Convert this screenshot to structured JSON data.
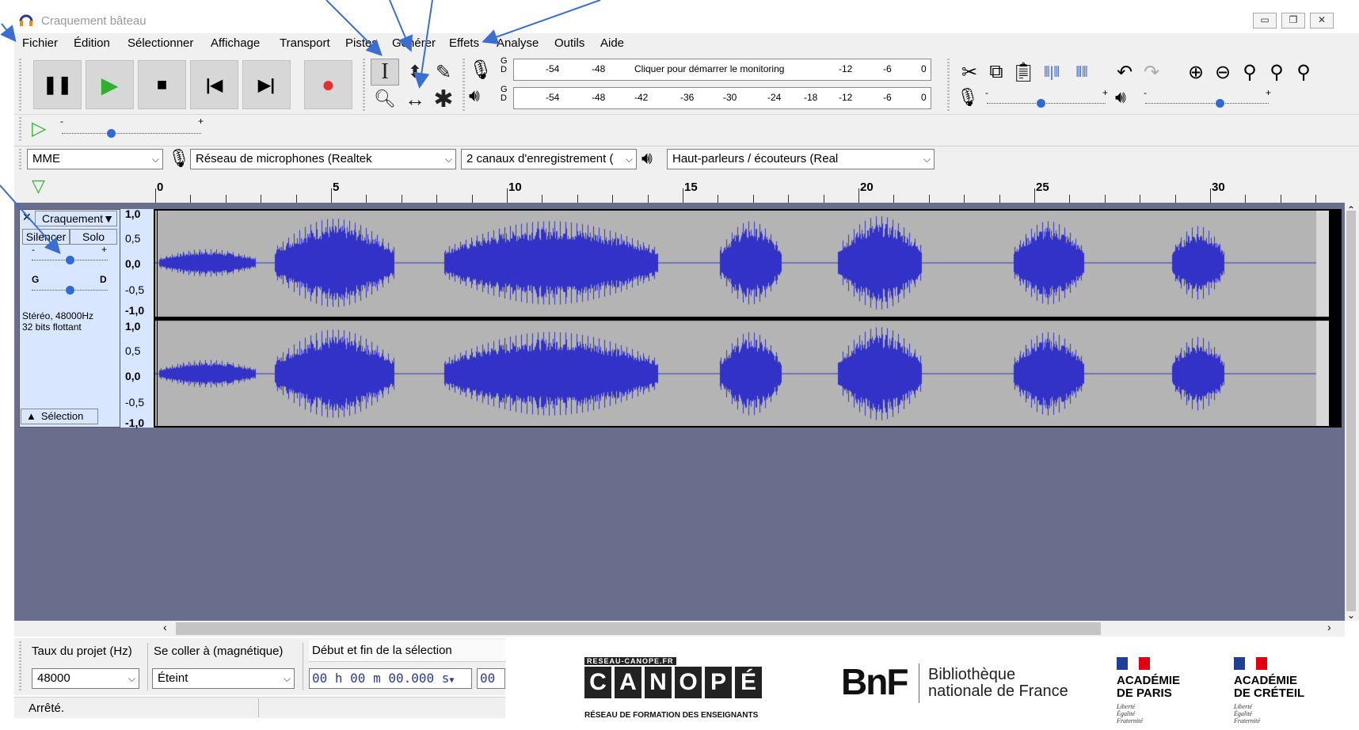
{
  "window": {
    "title": "Craquement bâteau",
    "controls": [
      "minimize",
      "restore",
      "close"
    ]
  },
  "menu": [
    "Fichier",
    "Édition",
    "Sélectionner",
    "Affichage",
    "Transport",
    "Pistes",
    "Générer",
    "Effets",
    "Analyse",
    "Outils",
    "Aide"
  ],
  "transport": {
    "buttons": [
      "pause-icon",
      "play-icon",
      "stop-icon",
      "skip-start-icon",
      "skip-end-icon",
      "record-icon"
    ]
  },
  "tools": [
    "selection-tool-icon",
    "envelope-tool-icon",
    "draw-tool-icon",
    "zoom-tool-icon",
    "timeshift-tool-icon",
    "multi-tool-icon"
  ],
  "meters": {
    "record": {
      "channels": [
        "G",
        "D"
      ],
      "labels": [
        "-54",
        "-48",
        "Cliquer pour démarrer le monitoring",
        "-12",
        "-6",
        "0"
      ]
    },
    "play": {
      "channels": [
        "G",
        "D"
      ],
      "labels": [
        "-54",
        "-48",
        "-42",
        "-36",
        "-30",
        "-24",
        "-18",
        "-12",
        "-6",
        "0"
      ]
    }
  },
  "mixer": {
    "min": "-",
    "max": "+",
    "record_volume": 0.45,
    "play_volume": 0.6
  },
  "play_at_speed": {
    "min": "-",
    "max": "+",
    "speed": 0.35
  },
  "devices": {
    "host": "MME",
    "input": "Réseau de microphones (Realtek",
    "channels": "2 canaux d'enregistrement (",
    "output": "Haut-parleurs / écouteurs (Real"
  },
  "timeline": {
    "labels": [
      "0",
      "5",
      "10",
      "15",
      "20",
      "25",
      "30"
    ],
    "max_seconds": 33
  },
  "track": {
    "name": "Craquement",
    "mute": "Silencer",
    "solo": "Solo",
    "gain_min": "-",
    "gain_max": "+",
    "pan_left": "G",
    "pan_right": "D",
    "info_line1": "Stéréo, 48000Hz",
    "info_line2": "32 bits flottant",
    "select_label": "Sélection",
    "scale": [
      "1,0",
      "0,5",
      "0,0",
      "-0,5",
      "-1,0"
    ],
    "gain": 0.5,
    "pan": 0.5
  },
  "bottom": {
    "rate_label": "Taux du projet (Hz)",
    "rate_value": "48000",
    "snap_label": "Se coller à (magnétique)",
    "snap_value": "Éteint",
    "selection_label": "Début et fin de la sélection",
    "selection_start": "00 h 00 m 00.000 s",
    "selection_end": "00",
    "status": "Arrêté."
  },
  "logos": {
    "canope_top": "RESEAU-CANOPE.FR",
    "canope_letters": [
      "C",
      "A",
      "N",
      "O",
      "P",
      "É"
    ],
    "canope_sub": "RÉSEAU DE FORMATION DES ENSEIGNANTS",
    "bnf": "BnF",
    "bnf_line1": "Bibliothèque",
    "bnf_line2": "nationale de France",
    "academy1_line1": "ACADÉMIE",
    "academy1_line2": "DE PARIS",
    "academy2_line1": "ACADÉMIE",
    "academy2_line2": "DE CRÉTEIL",
    "motto": [
      "Liberté",
      "Égalité",
      "Fraternité"
    ]
  },
  "colors": {
    "waveform": "#3232c8",
    "track_bg": "#b4b4b4",
    "empty_area": "#686e8c",
    "panel": "#d9e6ff",
    "record": "#e53030",
    "play": "#2fb12f",
    "annotation_arrow": "#3a6fd0"
  }
}
